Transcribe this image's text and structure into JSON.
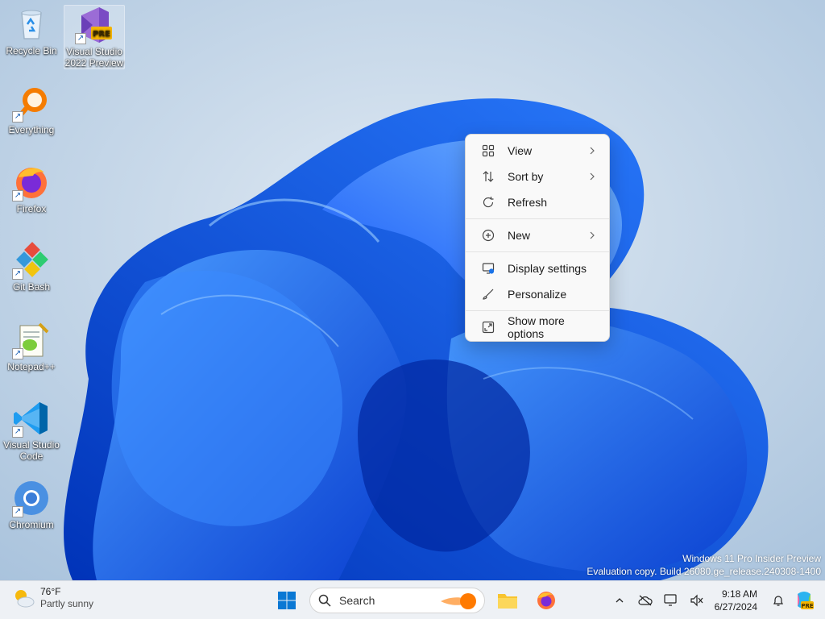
{
  "desktop": {
    "icons": [
      {
        "label": "Recycle Bin"
      },
      {
        "label": "Visual Studio 2022 Preview",
        "badge": "PRE"
      },
      {
        "label": "Everything"
      },
      {
        "label": "Firefox"
      },
      {
        "label": "Git Bash"
      },
      {
        "label": "Notepad++"
      },
      {
        "label": "Visual Studio Code"
      },
      {
        "label": "Chromium"
      }
    ]
  },
  "context_menu": {
    "items": [
      {
        "label": "View",
        "icon": "grid-view-icon",
        "submenu": true
      },
      {
        "label": "Sort by",
        "icon": "sort-icon",
        "submenu": true
      },
      {
        "label": "Refresh",
        "icon": "refresh-icon",
        "submenu": false
      },
      {
        "label": "New",
        "icon": "plus-circle-icon",
        "submenu": true
      },
      {
        "label": "Display settings",
        "icon": "display-settings-icon",
        "submenu": false
      },
      {
        "label": "Personalize",
        "icon": "brush-icon",
        "submenu": false
      },
      {
        "label": "Show more options",
        "icon": "expand-icon",
        "submenu": false
      }
    ]
  },
  "watermark": {
    "line1": "Windows 11 Pro Insider Preview",
    "line2": "Evaluation copy. Build 26080.ge_release.240308-1400"
  },
  "taskbar": {
    "weather": {
      "temp": "76°F",
      "condition": "Partly sunny"
    },
    "search_placeholder": "Search",
    "clock": {
      "time": "9:18 AM",
      "date": "6/27/2024"
    },
    "copilot_badge": "PRE"
  },
  "colors": {
    "accent": "#0067c0",
    "menu_bg": "#f9f9f9",
    "taskbar_bg": "#eef1f5"
  }
}
